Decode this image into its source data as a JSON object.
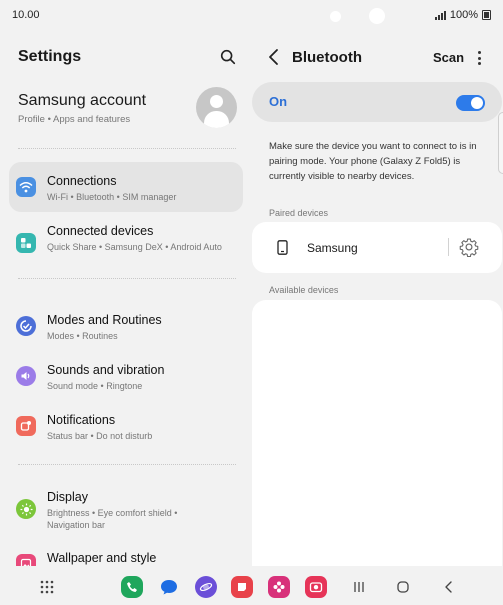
{
  "status_bar": {
    "time": "10.00",
    "battery": "100%"
  },
  "left": {
    "header": "Settings",
    "account": {
      "title": "Samsung account",
      "subtitle": "Profile  •  Apps and features"
    },
    "menu": [
      {
        "title": "Connections",
        "subtitle": "Wi-Fi  •  Bluetooth  •  SIM manager",
        "icon": "wifi-icon",
        "color": "#4a90e2"
      },
      {
        "title": "Connected devices",
        "subtitle": "Quick Share  •  Samsung DeX  •  Android Auto",
        "icon": "connected-devices-icon",
        "color": "#35b7b0"
      },
      {
        "title": "Modes and Routines",
        "subtitle": "Modes  •  Routines",
        "icon": "modes-icon",
        "color": "#4d6fd8"
      },
      {
        "title": "Sounds and vibration",
        "subtitle": "Sound mode  •  Ringtone",
        "icon": "speaker-icon",
        "color": "#9b7ce8"
      },
      {
        "title": "Notifications",
        "subtitle": "Status bar  •  Do not disturb",
        "icon": "notification-icon",
        "color": "#f06a5c"
      },
      {
        "title": "Display",
        "subtitle": "Brightness  •  Eye comfort shield  •  Navigation bar",
        "icon": "display-icon",
        "color": "#7cc63a"
      },
      {
        "title": "Wallpaper and style",
        "subtitle": "",
        "icon": "wallpaper-icon",
        "color": "#e8497a"
      }
    ]
  },
  "right": {
    "title": "Bluetooth",
    "scan_label": "Scan",
    "toggle_label": "On",
    "toggle_state": true,
    "info": "Make sure the device you want to connect to is in pairing mode. Your phone (Galaxy Z Fold5) is currently visible to nearby devices.",
    "paired_label": "Paired devices",
    "paired_devices": [
      {
        "name": "Samsung"
      }
    ],
    "available_label": "Available devices"
  },
  "colors": {
    "accent": "#2d7bea",
    "background": "#f2f2f2"
  }
}
